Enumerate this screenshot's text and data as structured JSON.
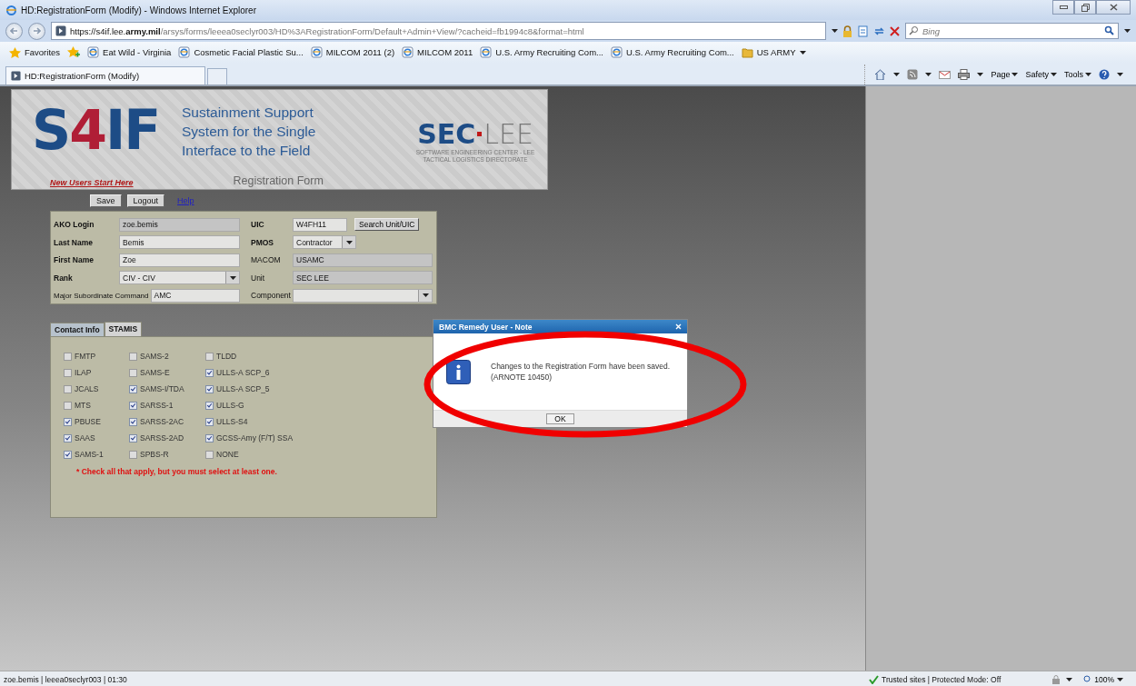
{
  "browser": {
    "title": "HD:RegistrationForm (Modify) - Windows Internet Explorer",
    "url_prefix": "https://s4if.lee.",
    "url_domain": "army.mil",
    "url_path": "/arsys/forms/leeea0seclyr003/HD%3ARegistrationForm/Default+Admin+View/?cacheid=fb1994c8&format=html",
    "search_placeholder": "Bing",
    "favorites_label": "Favorites",
    "favorites": [
      {
        "label": "Eat Wild - Virginia",
        "kind": "page"
      },
      {
        "label": "Cosmetic Facial Plastic Su...",
        "kind": "page"
      },
      {
        "label": "MILCOM 2011 (2)",
        "kind": "page"
      },
      {
        "label": "MILCOM 2011",
        "kind": "page"
      },
      {
        "label": "U.S. Army Recruiting Com...",
        "kind": "page"
      },
      {
        "label": "U.S. Army Recruiting Com...",
        "kind": "page"
      },
      {
        "label": "US ARMY",
        "kind": "folder"
      }
    ],
    "tab_title": "HD:RegistrationForm (Modify)",
    "commands": [
      "Page",
      "Safety",
      "Tools"
    ]
  },
  "banner": {
    "logo": [
      {
        "text": "S",
        "color": "#1d4c86"
      },
      {
        "text": "4",
        "color": "#b01e36"
      },
      {
        "text": "IF",
        "color": "#1d4c86"
      }
    ],
    "tagline": [
      "Sustainment Support",
      "System for the Single",
      "Interface to the Field"
    ],
    "org_logo": {
      "bold": "SEC",
      "light": "LEE",
      "lines": [
        "SOFTWARE ENGINEERING CENTER - LEE",
        "TACTICAL LOGISTICS DIRECTORATE"
      ]
    },
    "new_users_link": "New Users Start Here",
    "form_title": "Registration Form"
  },
  "actions": {
    "buttons": [
      "Save",
      "Logout"
    ],
    "help_link": "Help"
  },
  "form": {
    "left": [
      {
        "label": "AKO Login",
        "required": true,
        "kind": "text",
        "value": "zoe.bemis",
        "readonly": true
      },
      {
        "label": "Last Name",
        "required": true,
        "kind": "text",
        "value": "Bemis",
        "readonly": false
      },
      {
        "label": "First Name",
        "required": true,
        "kind": "text",
        "value": "Zoe",
        "readonly": false
      },
      {
        "label": "Rank",
        "required": true,
        "kind": "select",
        "value": "CIV - CIV",
        "readonly": false
      },
      {
        "label": "Major Subordinate Command",
        "required": false,
        "kind": "text",
        "value": "AMC",
        "readonly": false
      }
    ],
    "right": [
      {
        "label": "UIC",
        "required": true,
        "kind": "search",
        "value": "W4FH11",
        "readonly": false,
        "button": "Search Unit/UIC"
      },
      {
        "label": "PMOS",
        "required": true,
        "kind": "short-select",
        "value": "Contractor",
        "readonly": false
      },
      {
        "label": "MACOM",
        "required": false,
        "kind": "text",
        "value": "USAMC",
        "readonly": true
      },
      {
        "label": "Unit",
        "required": false,
        "kind": "text",
        "value": "SEC LEE",
        "readonly": true
      },
      {
        "label": "Component",
        "required": false,
        "kind": "select",
        "readonly": false
      }
    ]
  },
  "tabs": [
    {
      "label": "Contact Info",
      "selected": false
    },
    {
      "label": "STAMIS",
      "selected": true
    }
  ],
  "stamis": {
    "columns": [
      [
        {
          "label": "FMTP",
          "checked": false
        },
        {
          "label": "ILAP",
          "checked": false
        },
        {
          "label": "JCALS",
          "checked": false
        },
        {
          "label": "MTS",
          "checked": false
        },
        {
          "label": "PBUSE",
          "checked": true
        },
        {
          "label": "SAAS",
          "checked": true
        },
        {
          "label": "SAMS-1",
          "checked": true
        }
      ],
      [
        {
          "label": "SAMS-2",
          "checked": false
        },
        {
          "label": "SAMS-E",
          "checked": false
        },
        {
          "label": "SAMS-I/TDA",
          "checked": true
        },
        {
          "label": "SARSS-1",
          "checked": true
        },
        {
          "label": "SARSS-2AC",
          "checked": true
        },
        {
          "label": "SARSS-2AD",
          "checked": true
        },
        {
          "label": "SPBS-R",
          "checked": false
        }
      ],
      [
        {
          "label": "TLDD",
          "checked": false
        },
        {
          "label": "ULLS-A SCP_6",
          "checked": true
        },
        {
          "label": "ULLS-A SCP_5",
          "checked": true
        },
        {
          "label": "ULLS-G",
          "checked": true
        },
        {
          "label": "ULLS-S4",
          "checked": true
        },
        {
          "label": "GCSS-Amy (F/T) SSA",
          "checked": true
        },
        {
          "label": "NONE",
          "checked": false
        }
      ]
    ],
    "note": "* Check all that apply, but you must select at least one."
  },
  "dialog": {
    "title": "BMC Remedy User - Note",
    "message": "Changes to the Registration Form have been saved. (ARNOTE 10450)",
    "ok": "OK"
  },
  "status_bar": {
    "text": "zoe.bemis | leeea0seclyr003 | 01:30",
    "zone": "Trusted sites | Protected Mode: Off",
    "zoom": "100%"
  }
}
